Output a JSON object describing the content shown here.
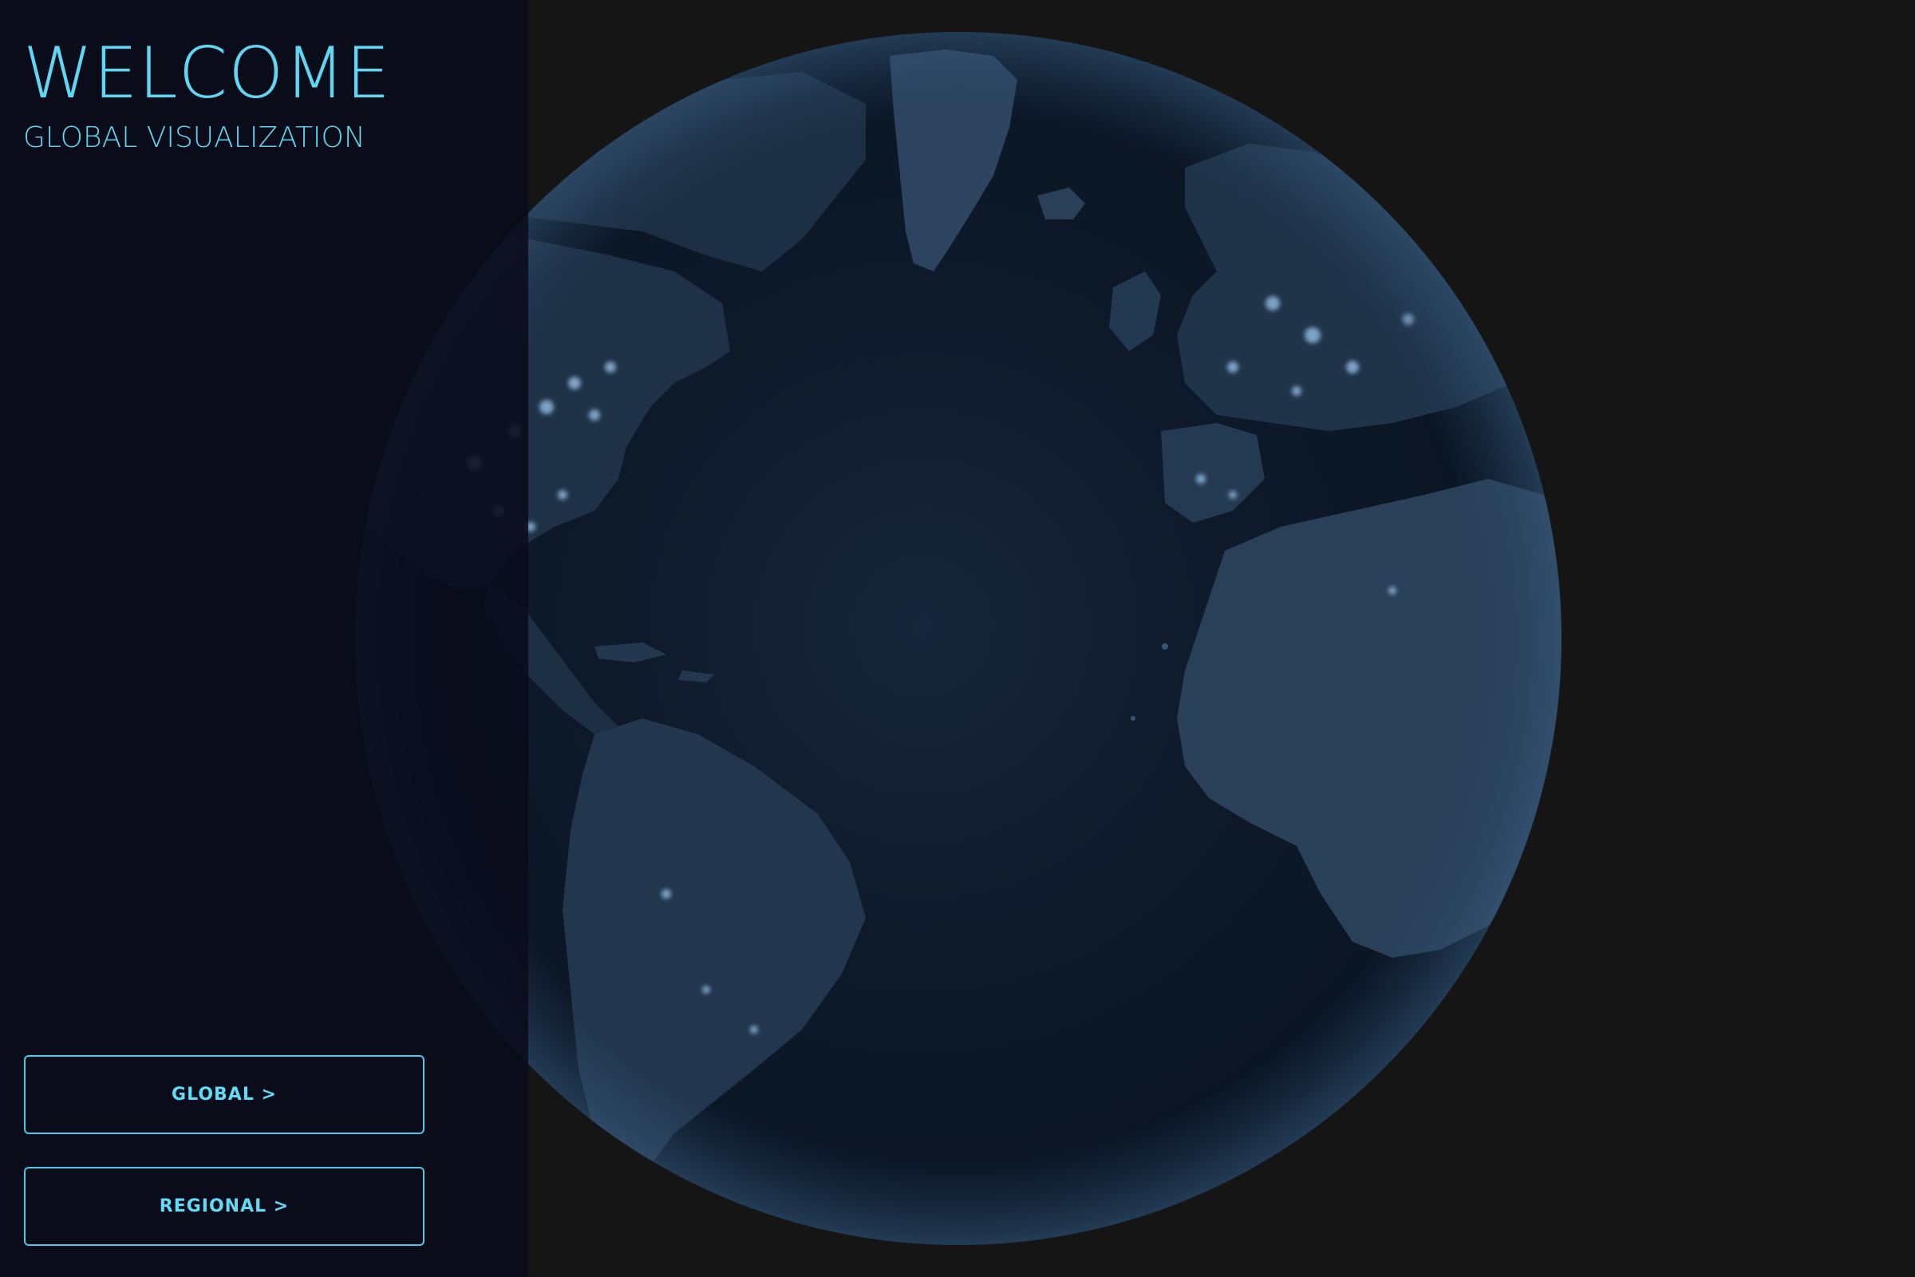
{
  "sidebar": {
    "title": "WELCOME",
    "subtitle": "GLOBAL VISUALIZATION",
    "buttons": {
      "global_label": "GLOBAL >",
      "regional_label": "REGIONAL >"
    }
  },
  "colors": {
    "accent": "#5fd7f3",
    "page_background": "#151515",
    "sidebar_background": "#0a0b1b",
    "ocean": "#0c1826",
    "land": "#24384e",
    "city_lights": "#9cc8f0"
  },
  "globe": {
    "style": "night-lights earth, centered on Atlantic Ocean",
    "visible_regions": [
      "Greenland",
      "North America",
      "South America",
      "Europe",
      "Africa"
    ]
  }
}
